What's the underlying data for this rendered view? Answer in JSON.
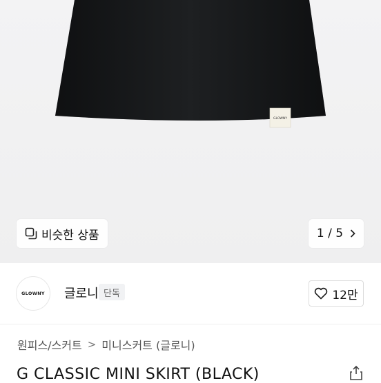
{
  "gallery": {
    "similar_label": "비슷한 상품",
    "counter": "1 / 5",
    "label_tag": "GLOWNY"
  },
  "brand": {
    "logo_text": "GLOWNY",
    "name": "글로니",
    "badge": "단독",
    "like_count": "12만"
  },
  "breadcrumb": {
    "category": "원피스/스커트",
    "subcategory": "미니스커트 (글로니)",
    "separator": ">"
  },
  "product": {
    "title": "G CLASSIC MINI SKIRT (BLACK)"
  },
  "colors": {
    "skirt": "#17191b",
    "background": "#f1f1f2"
  },
  "icons": {
    "similar": "gallery-stack-icon",
    "next": "chevron-right-icon",
    "like": "heart-outline-icon",
    "share": "share-icon"
  }
}
